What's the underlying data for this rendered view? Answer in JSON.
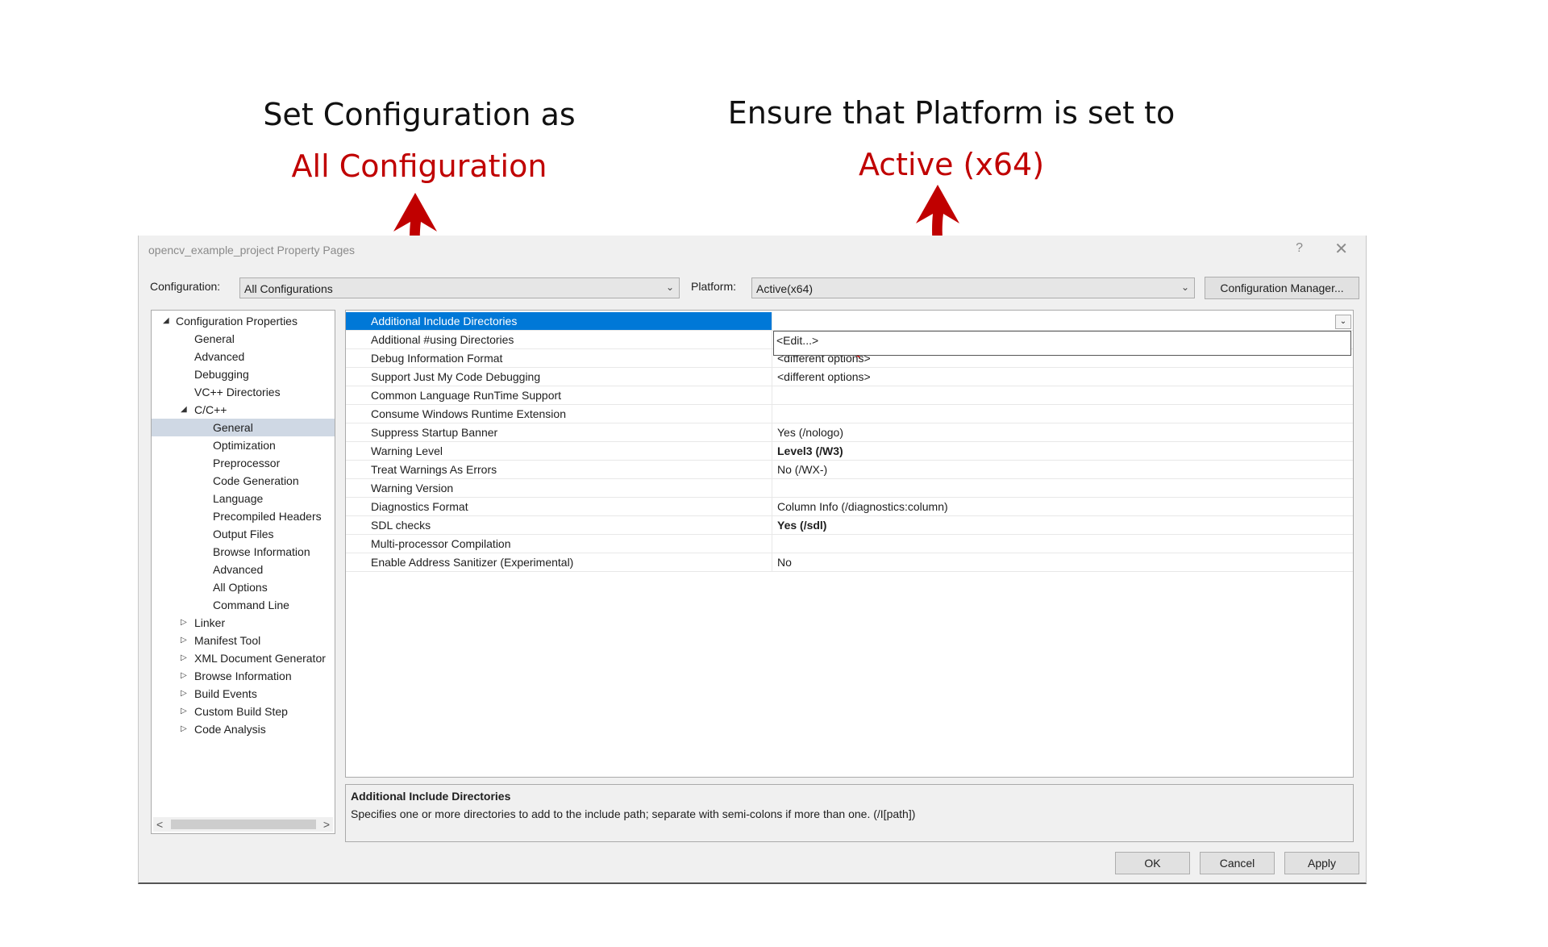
{
  "annotations": {
    "left": {
      "line1": "Set Configuration as",
      "line2": "All Configuration"
    },
    "right": {
      "line1": "Ensure that Platform is set to",
      "line2": "Active (x64)"
    }
  },
  "dialog": {
    "title": "opencv_example_project Property Pages",
    "help": "?",
    "close": "✕",
    "configuration_label": "Configuration:",
    "configuration_value": "All Configurations",
    "platform_label": "Platform:",
    "platform_value": "Active(x64)",
    "config_manager": "Configuration Manager...",
    "ok": "OK",
    "cancel": "Cancel",
    "apply": "Apply"
  },
  "tree": [
    {
      "label": "Configuration Properties",
      "level": 0,
      "expander": "◢"
    },
    {
      "label": "General",
      "level": 1
    },
    {
      "label": "Advanced",
      "level": 1
    },
    {
      "label": "Debugging",
      "level": 1
    },
    {
      "label": "VC++ Directories",
      "level": 1
    },
    {
      "label": "C/C++",
      "level": 1,
      "expander": "◢"
    },
    {
      "label": "General",
      "level": 2,
      "selected": true
    },
    {
      "label": "Optimization",
      "level": 2
    },
    {
      "label": "Preprocessor",
      "level": 2
    },
    {
      "label": "Code Generation",
      "level": 2
    },
    {
      "label": "Language",
      "level": 2
    },
    {
      "label": "Precompiled Headers",
      "level": 2
    },
    {
      "label": "Output Files",
      "level": 2
    },
    {
      "label": "Browse Information",
      "level": 2
    },
    {
      "label": "Advanced",
      "level": 2
    },
    {
      "label": "All Options",
      "level": 2
    },
    {
      "label": "Command Line",
      "level": 2
    },
    {
      "label": "Linker",
      "level": 1,
      "expander": "▷"
    },
    {
      "label": "Manifest Tool",
      "level": 1,
      "expander": "▷"
    },
    {
      "label": "XML Document Generator",
      "level": 1,
      "expander": "▷"
    },
    {
      "label": "Browse Information",
      "level": 1,
      "expander": "▷"
    },
    {
      "label": "Build Events",
      "level": 1,
      "expander": "▷"
    },
    {
      "label": "Custom Build Step",
      "level": 1,
      "expander": "▷"
    },
    {
      "label": "Code Analysis",
      "level": 1,
      "expander": "▷"
    }
  ],
  "scroll": {
    "left": "<",
    "right": ">"
  },
  "properties": [
    {
      "name": "Additional Include Directories",
      "value": "",
      "selected": true
    },
    {
      "name": "Additional #using Directories",
      "value": ""
    },
    {
      "name": "Debug Information Format",
      "value": "<different options>"
    },
    {
      "name": "Support Just My Code Debugging",
      "value": "<different options>"
    },
    {
      "name": "Common Language RunTime Support",
      "value": ""
    },
    {
      "name": "Consume Windows Runtime Extension",
      "value": ""
    },
    {
      "name": "Suppress Startup Banner",
      "value": "Yes (/nologo)"
    },
    {
      "name": "Warning Level",
      "value": "Level3 (/W3)",
      "bold": true
    },
    {
      "name": "Treat Warnings As Errors",
      "value": "No (/WX-)"
    },
    {
      "name": "Warning Version",
      "value": ""
    },
    {
      "name": "Diagnostics Format",
      "value": "Column Info (/diagnostics:column)"
    },
    {
      "name": "SDL checks",
      "value": "Yes (/sdl)",
      "bold": true
    },
    {
      "name": "Multi-processor Compilation",
      "value": ""
    },
    {
      "name": "Enable Address Sanitizer (Experimental)",
      "value": "No"
    }
  ],
  "edit_popup": "<Edit...>",
  "description": {
    "title": "Additional Include Directories",
    "text": "Specifies one or more directories to add to the include path; separate with semi-colons if more than one.     (/I[path])"
  },
  "colors": {
    "annotation_red": "#c00000",
    "selection_blue": "#0078d7"
  },
  "icons": {
    "dropdown": "⌄"
  }
}
